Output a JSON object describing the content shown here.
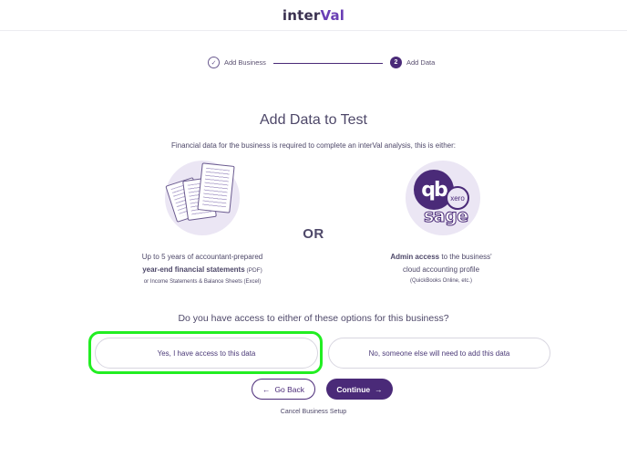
{
  "header": {
    "logo_text_start": "inter",
    "logo_text_accent": "Val"
  },
  "stepper": {
    "steps": [
      {
        "label": "Add Business",
        "marker": "✓",
        "state": "complete"
      },
      {
        "label": "Add Data",
        "marker": "2",
        "state": "active"
      }
    ]
  },
  "main": {
    "title": "Add Data to Test",
    "subtitle": "Financial data for the business is required to complete an interVal analysis, this is either:",
    "or_label": "OR",
    "option_left": {
      "line1": "Up to 5 years of accountant-prepared",
      "line2_bold": "year-end financial statements",
      "line2_suffix": " (PDF)",
      "line3": "or Income Statements & Balance Sheets (Excel)",
      "icon": "financial-statements-icon"
    },
    "option_right": {
      "line1_bold": "Admin access",
      "line1_suffix": " to the business'",
      "line2": "cloud accounting profile",
      "line3": "(QuickBooks Online, etc.)",
      "icon": "accounting-software-logos-icon",
      "qb_label": "qb",
      "xero_label": "xero",
      "sage_label": "sage"
    },
    "question": "Do you have access to either of these options for this business?",
    "choices": {
      "yes": "Yes, I have access to this data",
      "no": "No, someone else will need to add this data"
    },
    "buttons": {
      "back": "Go Back",
      "back_icon": "←",
      "continue": "Continue",
      "continue_icon": "→"
    },
    "cancel": "Cancel Business Setup"
  },
  "colors": {
    "brand": "#4a2a78",
    "highlight": "#22ee22",
    "illustration_bg": "#ebe6f4"
  }
}
